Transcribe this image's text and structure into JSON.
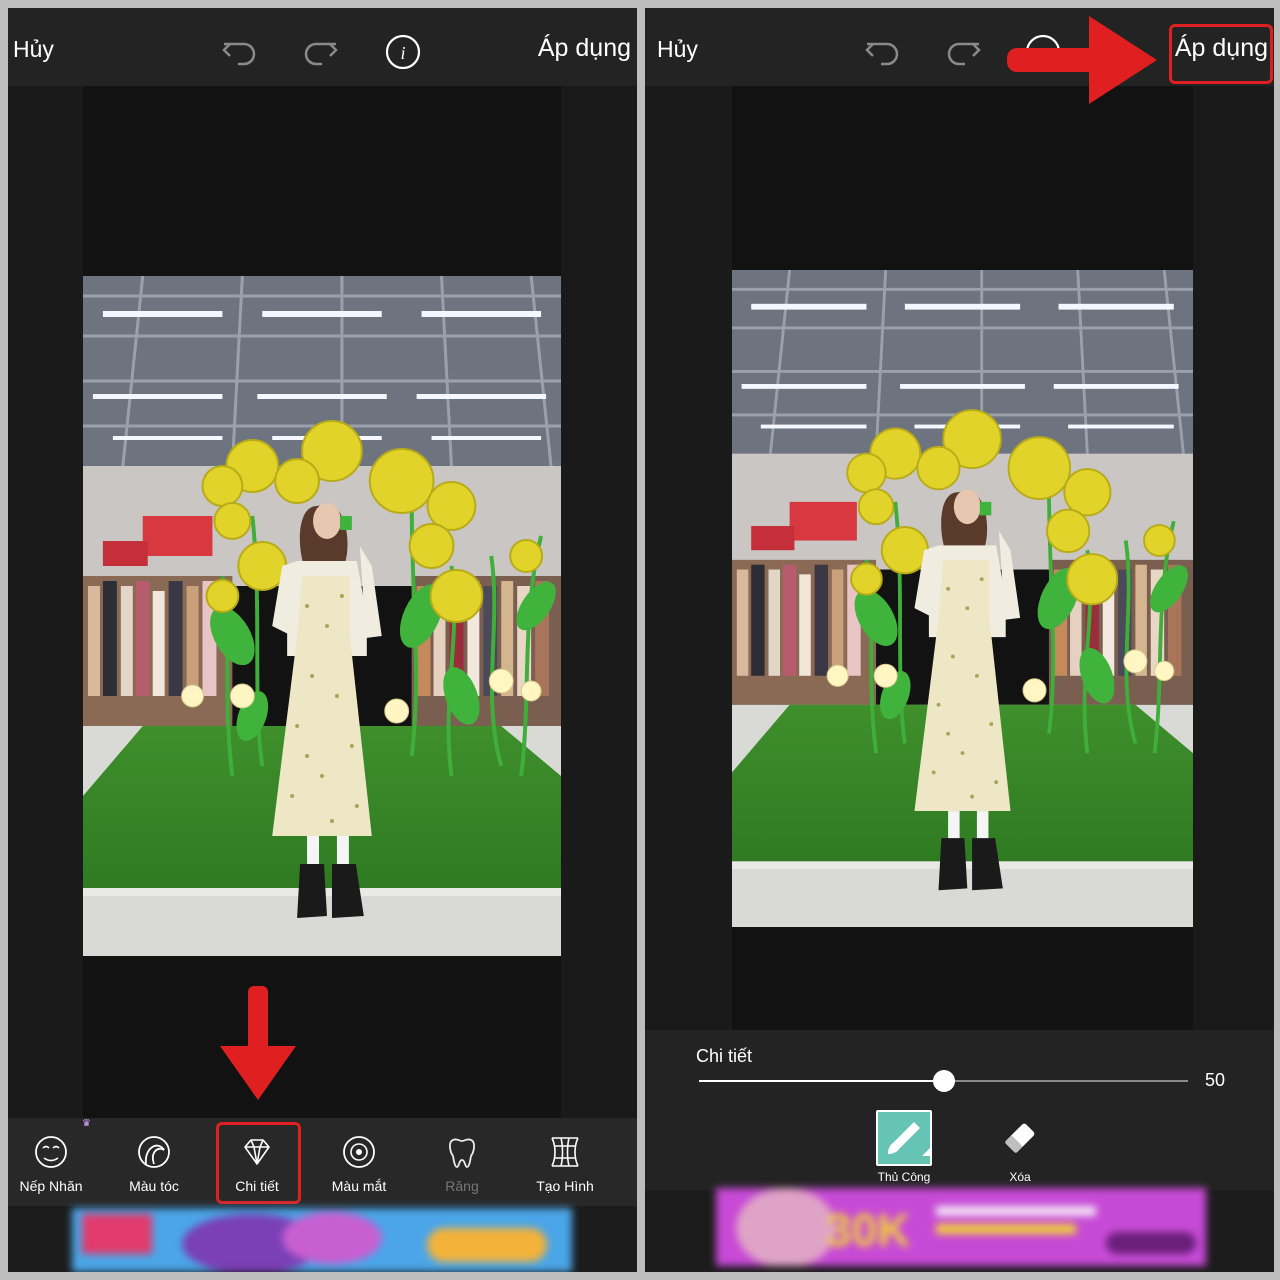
{
  "left_screen": {
    "header": {
      "cancel_label": "Hủy",
      "apply_label": "Áp dụng"
    },
    "tools": [
      {
        "label": "Nếp Nhăn",
        "icon": "face-wrinkle-icon",
        "premium": true
      },
      {
        "label": "Màu tóc",
        "icon": "hair-color-icon",
        "premium": false
      },
      {
        "label": "Chi tiết",
        "icon": "diamond-icon",
        "premium": false,
        "highlighted": true
      },
      {
        "label": "Màu mắt",
        "icon": "eye-color-icon",
        "premium": false
      },
      {
        "label": "Răng",
        "icon": "tooth-icon",
        "premium": false,
        "disabled": true
      },
      {
        "label": "Tạo Hình",
        "icon": "reshape-grid-icon",
        "premium": false
      }
    ]
  },
  "right_screen": {
    "header": {
      "cancel_label": "Hủy",
      "apply_label": "Áp dụng",
      "apply_highlighted": true
    },
    "adjust": {
      "label": "Chi tiết",
      "value": "50",
      "value_fraction": 0.5
    },
    "modes": [
      {
        "label": "Thủ Công",
        "icon": "brush-icon",
        "active": true
      },
      {
        "label": "Xóa",
        "icon": "eraser-icon",
        "active": false
      }
    ]
  },
  "colors": {
    "annotation_red": "#e02020",
    "active_mode": "#66c4b4",
    "background": "#1c1c1c"
  }
}
